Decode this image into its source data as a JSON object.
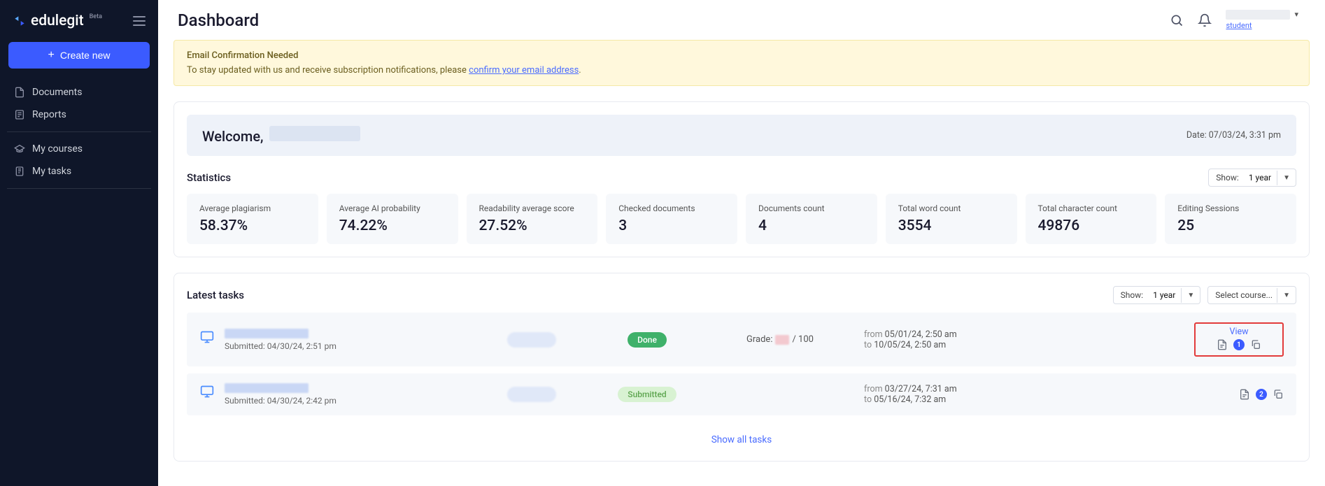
{
  "brand": {
    "name": "edulegit",
    "tag": "Beta"
  },
  "sidebar": {
    "create_label": "Create new",
    "group1": [
      {
        "label": "Documents"
      },
      {
        "label": "Reports"
      }
    ],
    "group2": [
      {
        "label": "My courses"
      },
      {
        "label": "My tasks"
      }
    ]
  },
  "header": {
    "title": "Dashboard",
    "user_role": "student"
  },
  "banner": {
    "title": "Email Confirmation Needed",
    "text_prefix": "To stay updated with us and receive subscription notifications, please ",
    "link_text": "confirm your email address",
    "text_suffix": "."
  },
  "welcome": {
    "greeting": "Welcome,",
    "date_label": "Date:",
    "date_value": "07/03/24, 3:31 pm"
  },
  "stats": {
    "title": "Statistics",
    "show_label": "Show:",
    "show_value": "1 year",
    "items": [
      {
        "label": "Average plagiarism",
        "value": "58.37%"
      },
      {
        "label": "Average AI probability",
        "value": "74.22%"
      },
      {
        "label": "Readability average score",
        "value": "27.52%"
      },
      {
        "label": "Checked documents",
        "value": "3"
      },
      {
        "label": "Documents count",
        "value": "4"
      },
      {
        "label": "Total word count",
        "value": "3554"
      },
      {
        "label": "Total character count",
        "value": "49876"
      },
      {
        "label": "Editing Sessions",
        "value": "25"
      }
    ]
  },
  "tasks": {
    "title": "Latest tasks",
    "show_label": "Show:",
    "show_value": "1 year",
    "select_course_ph": "Select course...",
    "view_label": "View",
    "grade_label": "Grade:",
    "grade_suffix": " / 100",
    "from_label": "from",
    "to_label": "to",
    "submitted_label_prefix": "Submitted:",
    "rows": [
      {
        "submitted": "04/30/24, 2:51 pm",
        "status": "Done",
        "status_class": "badge-done",
        "from": "05/01/24, 2:50 am",
        "to": "10/05/24, 2:50 am",
        "doc_count": "1",
        "has_grade": true,
        "highlight": true
      },
      {
        "submitted": "04/30/24, 2:42 pm",
        "status": "Submitted",
        "status_class": "badge-submitted",
        "from": "03/27/24, 7:31 am",
        "to": "05/16/24, 7:32 am",
        "doc_count": "2",
        "has_grade": false,
        "highlight": false
      }
    ],
    "show_all": "Show all tasks"
  }
}
